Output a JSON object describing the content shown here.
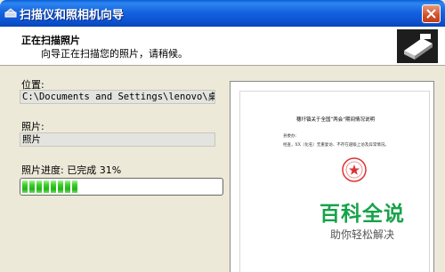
{
  "window": {
    "title": "扫描仪和照相机向导",
    "title_icon": "scanner-camera-icon",
    "close_icon": "close-icon"
  },
  "header": {
    "title": "正在扫描照片",
    "subtitle": "向导正在扫描您的照片，请稍候。",
    "logo_icon": "scanner-wizard-icon"
  },
  "location": {
    "label": "位置:",
    "value": "C:\\Documents and Settings\\lenovo\\桌面"
  },
  "photo": {
    "label": "照片:",
    "value": "照片"
  },
  "progress": {
    "label": "照片进度: 已完成 31%",
    "percent": 31
  },
  "preview": {
    "doc_title": "穗圩镇关于全国“两会”期间情况说明",
    "doc_lines": [
      "县委办：",
      "经查，XX（化名）无重复访、不存在越级上访及异常情况。"
    ]
  },
  "watermark": {
    "title": "百科全说",
    "subtitle": "助你轻松解决"
  },
  "colors": {
    "titlebar": "#0b52d2",
    "progress_fill": "#3ecf2a",
    "watermark": "#17a34a"
  }
}
